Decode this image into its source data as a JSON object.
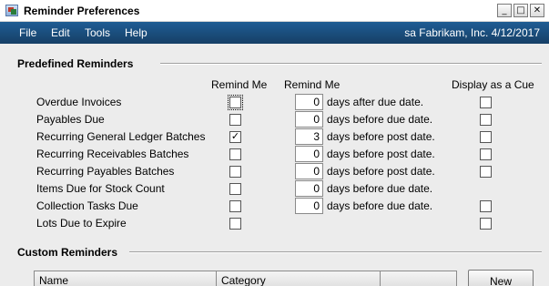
{
  "window": {
    "title": "Reminder Preferences",
    "controls": {
      "minimize": "_",
      "maximize": "□",
      "close": "✕"
    }
  },
  "menu": {
    "items": [
      "File",
      "Edit",
      "Tools",
      "Help"
    ],
    "status": "sa  Fabrikam, Inc.  4/12/2017"
  },
  "predefined": {
    "title": "Predefined Reminders",
    "col_remind_me_1": "Remind Me",
    "col_remind_me_2": "Remind Me",
    "col_display_cue": "Display as a Cue",
    "rows": [
      {
        "label": "Overdue Invoices",
        "remind": false,
        "focused": true,
        "days": "0",
        "unit": "days after due date.",
        "cue": false,
        "has_days": true,
        "has_cue": true
      },
      {
        "label": "Payables Due",
        "remind": false,
        "focused": false,
        "days": "0",
        "unit": "days before due date.",
        "cue": false,
        "has_days": true,
        "has_cue": true
      },
      {
        "label": "Recurring General Ledger Batches",
        "remind": true,
        "focused": false,
        "days": "3",
        "unit": "days before post date.",
        "cue": false,
        "has_days": true,
        "has_cue": true
      },
      {
        "label": "Recurring Receivables Batches",
        "remind": false,
        "focused": false,
        "days": "0",
        "unit": "days before post date.",
        "cue": false,
        "has_days": true,
        "has_cue": true
      },
      {
        "label": "Recurring Payables Batches",
        "remind": false,
        "focused": false,
        "days": "0",
        "unit": "days before post date.",
        "cue": false,
        "has_days": true,
        "has_cue": true
      },
      {
        "label": "Items Due for Stock Count",
        "remind": false,
        "focused": false,
        "days": "0",
        "unit": "days before due date.",
        "cue": false,
        "has_days": true,
        "has_cue": false
      },
      {
        "label": "Collection Tasks Due",
        "remind": false,
        "focused": false,
        "days": "0",
        "unit": "days before due date.",
        "cue": false,
        "has_days": true,
        "has_cue": true
      },
      {
        "label": "Lots Due to Expire",
        "remind": false,
        "focused": false,
        "days": "",
        "unit": "",
        "cue": false,
        "has_days": false,
        "has_cue": true
      }
    ]
  },
  "custom": {
    "title": "Custom Reminders",
    "columns": [
      "Name",
      "Category",
      ""
    ],
    "new_label": "New"
  },
  "checkmark_glyph": "✓"
}
